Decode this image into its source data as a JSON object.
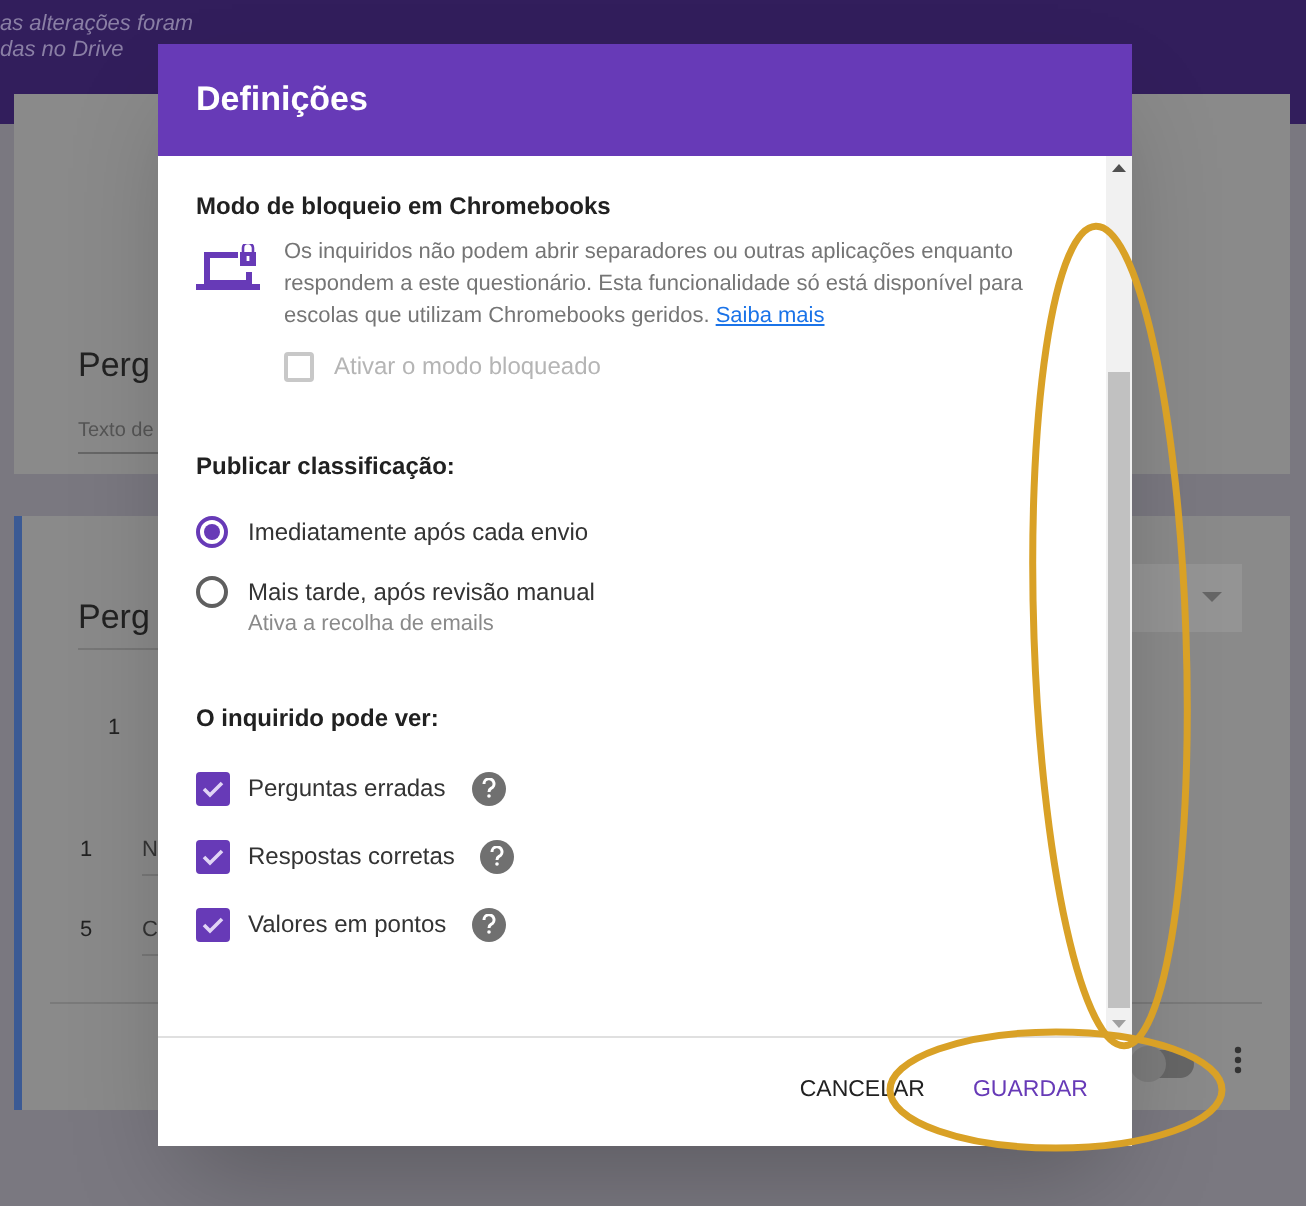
{
  "background": {
    "save_notice": [
      "as alterações foram",
      "das no Drive"
    ],
    "card_1": {
      "title": "Perg",
      "description_placeholder": "Texto de"
    },
    "card_2": {
      "title": "Perg",
      "scale_start": "1",
      "labels": [
        {
          "number": "1",
          "text": "N"
        },
        {
          "number": "5",
          "text": "C"
        }
      ],
      "required_toggle": {
        "on": false
      }
    }
  },
  "dialog": {
    "title": "Definições",
    "lockdown": {
      "heading": "Modo de bloqueio em Chromebooks",
      "description": "Os inquiridos não podem abrir separadores ou outras aplicações enquanto respondem a este questionário. Esta funcionalidade só está disponível para escolas que utilizam Chromebooks geridos.",
      "link": "Saiba mais",
      "checkbox": {
        "label": "Ativar o modo bloqueado",
        "checked": false,
        "disabled": true
      }
    },
    "release_grade": {
      "heading": "Publicar classificação:",
      "options": [
        {
          "label": "Imediatamente após cada envio",
          "selected": true
        },
        {
          "label": "Mais tarde, após revisão manual",
          "note": "Ativa a recolha de emails",
          "selected": false
        }
      ]
    },
    "respondent_can_see": {
      "heading": "O inquirido pode ver:",
      "options": [
        {
          "label": "Perguntas erradas",
          "checked": true
        },
        {
          "label": "Respostas corretas",
          "checked": true
        },
        {
          "label": "Valores em pontos",
          "checked": true
        }
      ]
    },
    "buttons": [
      {
        "label": "CANCELAR",
        "kind": "plain"
      },
      {
        "label": "GUARDAR",
        "kind": "primary"
      }
    ]
  }
}
